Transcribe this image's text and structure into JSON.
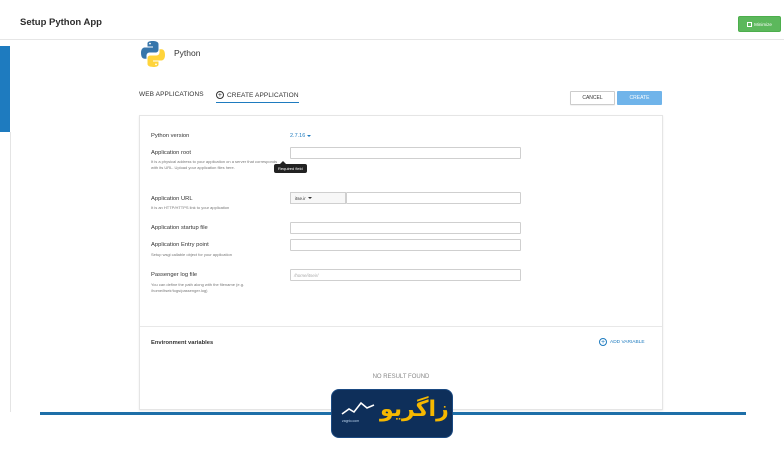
{
  "app": {
    "title": "Setup Python App",
    "minimize_label": "Minimize"
  },
  "python": {
    "name": "Python"
  },
  "tabs": {
    "web_applications": "WEB APPLICATIONS",
    "create_application": "CREATE APPLICATION"
  },
  "actions": {
    "cancel": "CANCEL",
    "create": "CREATE"
  },
  "form": {
    "python_version_label": "Python version",
    "python_version_value": "2.7.16",
    "app_root_label": "Application root",
    "app_root_help": "It is a physical address to your application on a server that corresponds with its URL. Upload your application files here.",
    "tooltip": "Required field",
    "app_url_label": "Application URL",
    "app_url_help": "It is an HTTP/HTTPS link to your application",
    "app_url_prefix": "itse.ir",
    "startup_label": "Application startup file",
    "entry_label": "Application Entry point",
    "entry_help": "Setup wsgi callable object for your application",
    "log_label": "Passenger log file",
    "log_placeholder": "/home/itseir/",
    "log_help": "You can define the path along with the filename (e.g. /home/itseir/logs/passenger.log)"
  },
  "env": {
    "label": "Environment variables",
    "add_label": "ADD VARIABLE",
    "empty_text": "NO RESULT FOUND"
  },
  "watermark": {
    "text": "زاگریو",
    "sub": "zagrio.com"
  },
  "colors": {
    "accent": "#1e7bbf",
    "create_button": "#70b4ea",
    "minimize_button": "#5cb85c",
    "watermark_bg": "#0e2f5a",
    "watermark_text": "#f5b800"
  }
}
